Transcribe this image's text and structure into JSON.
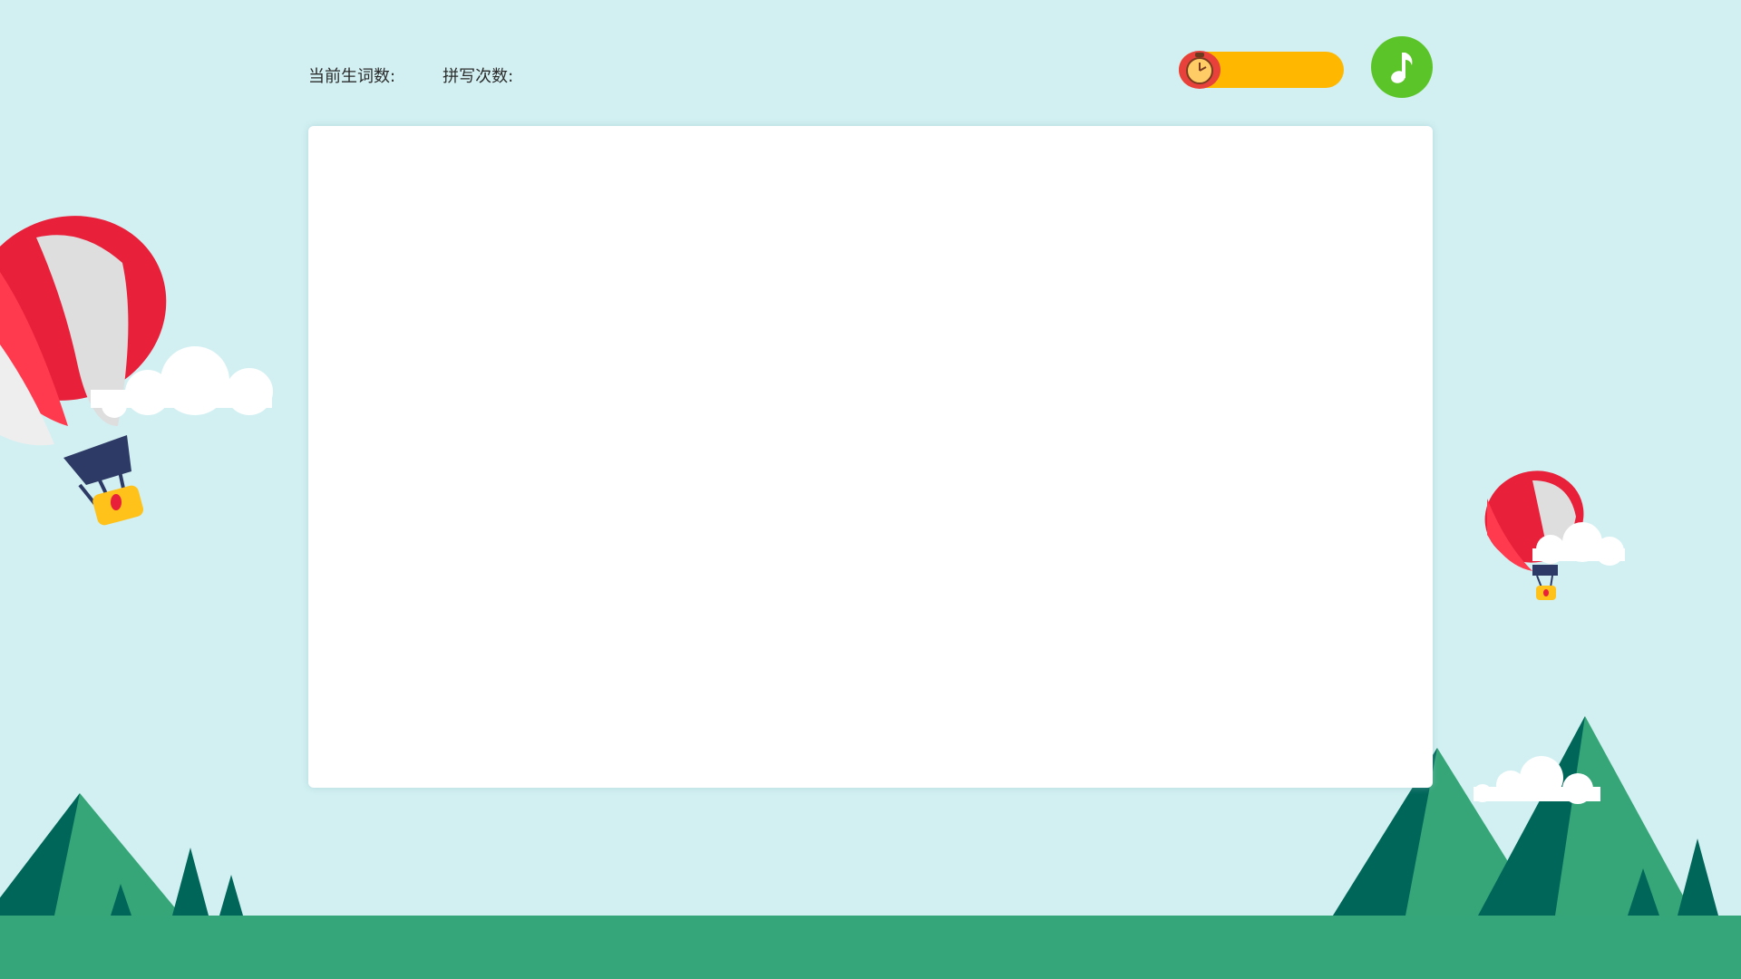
{
  "stats": {
    "current_words_label": "当前生词数:",
    "current_words_value": "",
    "spell_count_label": "拼写次数:",
    "spell_count_value": ""
  },
  "icons": {
    "timer": "alarm-clock-icon",
    "music": "music-note-icon"
  },
  "colors": {
    "background": "#d2f0f2",
    "ground": "#35a67a",
    "mountain_light": "#36a678",
    "mountain_dark": "#00665a",
    "timer_bar": "#ffb700",
    "timer_icon": "#e8413c",
    "music_button": "#5bc428",
    "card": "#ffffff"
  }
}
